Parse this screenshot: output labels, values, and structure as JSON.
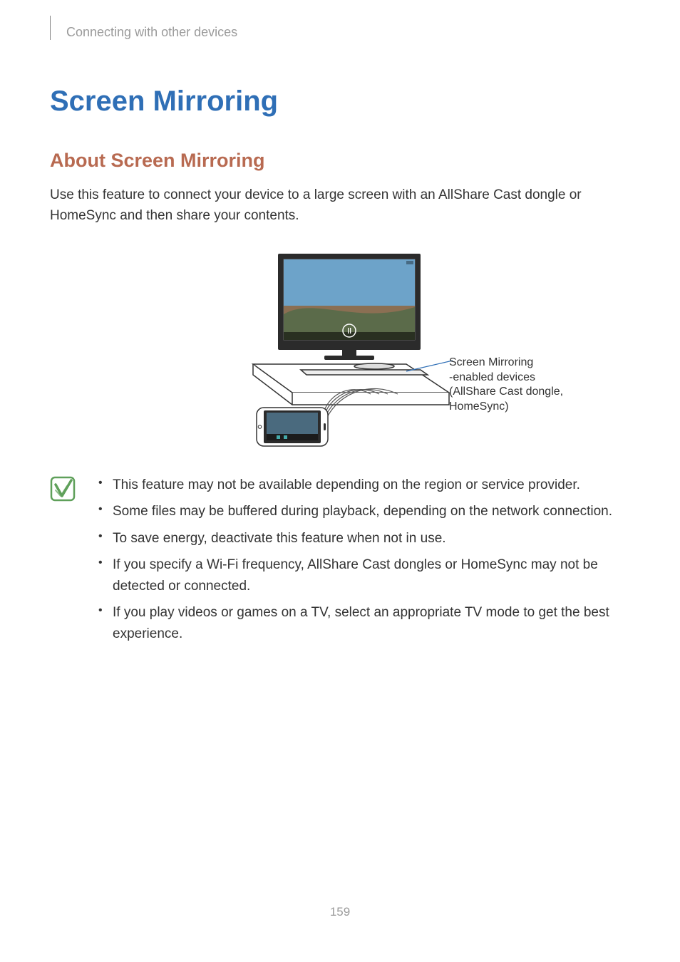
{
  "header": {
    "running": "Connecting with other devices"
  },
  "title": "Screen Mirroring",
  "subtitle": "About Screen Mirroring",
  "lead": "Use this feature to connect your device to a large screen with an AllShare Cast dongle or HomeSync and then share your contents.",
  "callout": {
    "l1": "Screen Mirroring",
    "l2": "-enabled devices",
    "l3": "(AllShare Cast dongle,",
    "l4": "HomeSync)"
  },
  "notes": [
    "This feature may not be available depending on the region or service provider.",
    "Some files may be buffered during playback, depending on the network connection.",
    "To save energy, deactivate this feature when not in use.",
    "If you specify a Wi-Fi frequency, AllShare Cast dongles or HomeSync may not be detected or connected.",
    "If you play videos or games on a TV, select an appropriate TV mode to get the best experience."
  ],
  "pageNumber": "159"
}
